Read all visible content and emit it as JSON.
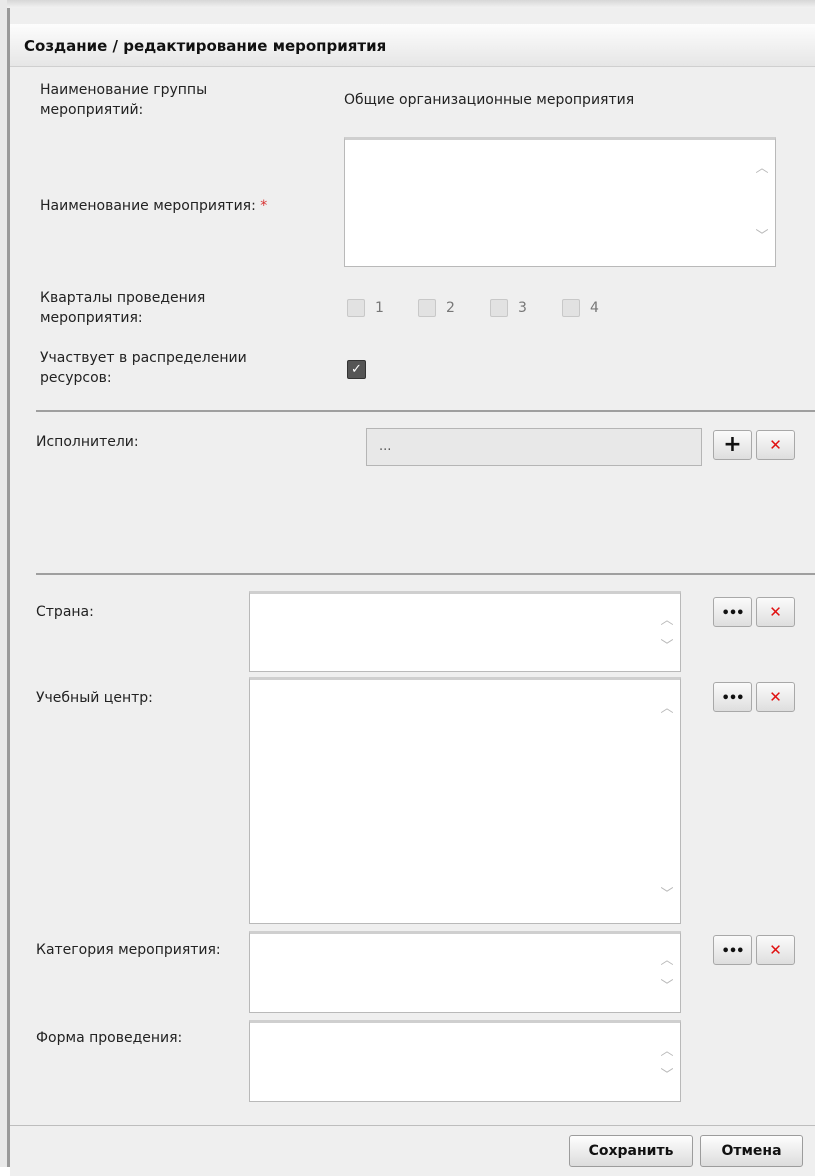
{
  "dialog": {
    "title": "Создание / редактирование мероприятия"
  },
  "form": {
    "group_label_line1": "Наименование группы",
    "group_label_line2": "мероприятий:",
    "group_value": "Общие организационные мероприятия",
    "event_name_label": "Наименование мероприятия:",
    "required_mark": "*",
    "quarters_label_line1": "Кварталы проведения",
    "quarters_label_line2": "мероприятия:",
    "quarters": [
      {
        "number": "1",
        "checked": false
      },
      {
        "number": "2",
        "checked": false
      },
      {
        "number": "3",
        "checked": false
      },
      {
        "number": "4",
        "checked": false
      }
    ],
    "resources_label_line1": "Участвует в распределении",
    "resources_label_line2": "ресурсов:",
    "resources_checked": true,
    "executors_label": "Исполнители:",
    "executors_value": "...",
    "country_label": "Страна:",
    "training_center_label": "Учебный центр:",
    "category_label": "Категория мероприятия:",
    "form_label": "Форма проведения:"
  },
  "icons": {
    "plus": "+",
    "cross": "✕",
    "dots": "•••",
    "check": "✓",
    "scroll_up": "︿",
    "scroll_down": "﹀"
  },
  "footer": {
    "save_label": "Сохранить",
    "cancel_label": "Отмена"
  },
  "colors": {
    "dialog_bg": "#efefef",
    "required": "#d83030",
    "delete_icon": "#e01010"
  }
}
